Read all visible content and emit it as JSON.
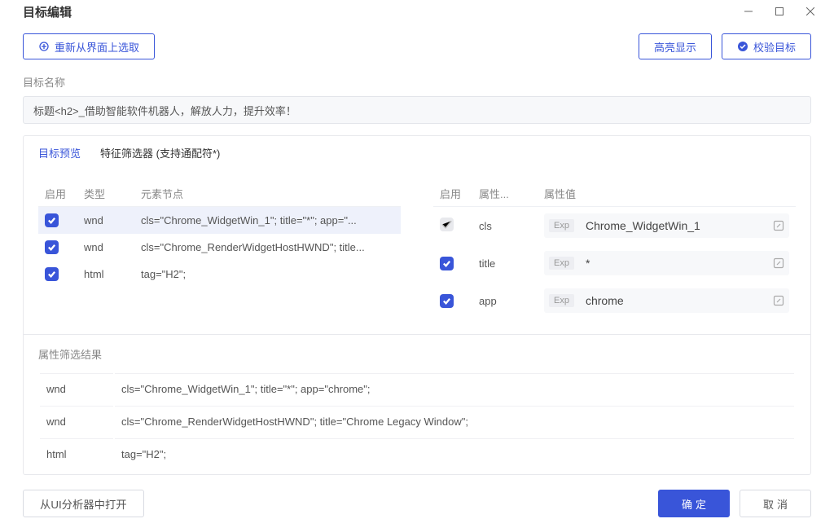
{
  "window": {
    "title": "目标编辑"
  },
  "topbar": {
    "repick": "重新从界面上选取",
    "highlight": "高亮显示",
    "validate": "校验目标"
  },
  "name": {
    "label": "目标名称",
    "value": "标题<h2>_借助智能软件机器人，解放人力，提升效率！"
  },
  "tabs": {
    "preview": "目标预览",
    "filter": "特征筛选器 (支持通配符*)"
  },
  "left": {
    "headers": {
      "enable": "启用",
      "type": "类型",
      "node": "元素节点"
    },
    "rows": [
      {
        "enabled": true,
        "selected": true,
        "type": "wnd",
        "node": "cls=\"Chrome_WidgetWin_1\"; title=\"*\"; app=\"..."
      },
      {
        "enabled": true,
        "selected": false,
        "type": "wnd",
        "node": "cls=\"Chrome_RenderWidgetHostHWND\"; title..."
      },
      {
        "enabled": true,
        "selected": false,
        "type": "html",
        "node": "tag=\"H2\";"
      }
    ]
  },
  "right": {
    "headers": {
      "enable": "启用",
      "attr": "属性...",
      "value": "属性值"
    },
    "expTag": "Exp",
    "rows": [
      {
        "enabled": false,
        "locked": true,
        "attr": "cls",
        "value": "Chrome_WidgetWin_1"
      },
      {
        "enabled": true,
        "locked": false,
        "attr": "title",
        "value": "*"
      },
      {
        "enabled": true,
        "locked": false,
        "attr": "app",
        "value": "chrome"
      }
    ]
  },
  "results": {
    "title": "属性筛选结果",
    "rows": [
      {
        "type": "wnd",
        "desc": "cls=\"Chrome_WidgetWin_1\"; title=\"*\"; app=\"chrome\";"
      },
      {
        "type": "wnd",
        "desc": "cls=\"Chrome_RenderWidgetHostHWND\"; title=\"Chrome Legacy Window\";"
      },
      {
        "type": "html",
        "desc": "tag=\"H2\";"
      }
    ]
  },
  "footer": {
    "openAnalyzer": "从UI分析器中打开",
    "ok": "确定",
    "cancel": "取消"
  }
}
